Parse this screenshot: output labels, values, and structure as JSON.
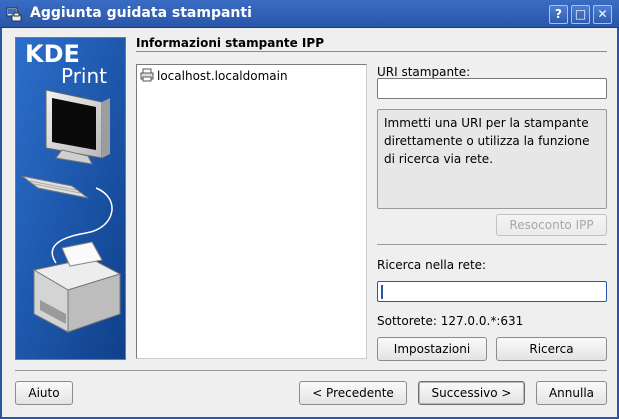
{
  "window": {
    "title": "Aggiunta guidata stampanti",
    "buttons": {
      "help": "?",
      "maximize": "□",
      "close": "✕"
    }
  },
  "banner": {
    "logo_line1": "KDE",
    "logo_line2": "Print"
  },
  "section": {
    "title": "Informazioni stampante IPP"
  },
  "devices": [
    {
      "label": "localhost.localdomain",
      "icon": "printer-icon"
    }
  ],
  "uri": {
    "label": "URI stampante:",
    "value": "",
    "placeholder": ""
  },
  "info_text": "Immetti una URI per la stampante direttamente o utilizza la funzione di ricerca via rete.",
  "report_button": "Resoconto IPP",
  "network": {
    "label": "Ricerca nella rete:",
    "value": "",
    "subnet": "Sottorete: 127.0.0.*:631",
    "settings_button": "Impostazioni",
    "search_button": "Ricerca"
  },
  "footer": {
    "help": "Aiuto",
    "back": "< Precedente",
    "next": "Successivo >",
    "cancel": "Annulla"
  },
  "colors": {
    "titlebar": "#2a56a8",
    "banner_bg": "#1f5fb8",
    "accent": "#2a56a8"
  }
}
